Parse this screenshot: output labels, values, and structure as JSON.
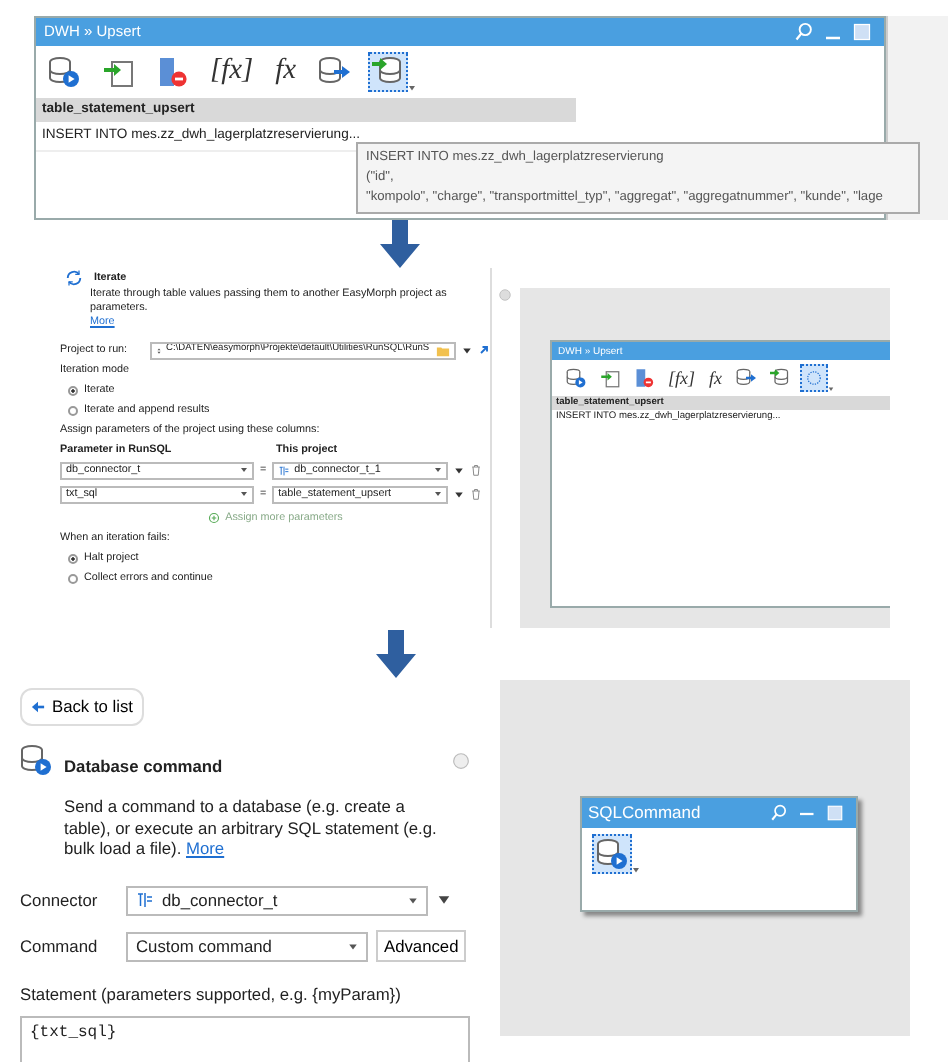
{
  "top_window": {
    "title": "DWH » Upsert",
    "toolbar": [
      {
        "kind": "db-run",
        "selected": false
      },
      {
        "kind": "import",
        "selected": false
      },
      {
        "kind": "remove-column",
        "selected": false
      },
      {
        "kind": "glyph",
        "text": "[fx]",
        "selected": false
      },
      {
        "kind": "glyph",
        "text": "fx",
        "selected": false
      },
      {
        "kind": "export",
        "selected": false
      },
      {
        "kind": "upsert",
        "selected": true
      }
    ],
    "table": {
      "columns": [
        "table_statement_upsert"
      ],
      "rows": [
        "INSERT INTO mes.zz_dwh_lagerplatzreservierung..."
      ]
    },
    "tooltip": {
      "lines": [
        "INSERT INTO mes.zz_dwh_lagerplatzreservierung",
        "(\"id\",",
        "\"kompolo\", \"charge\", \"transportmittel_typ\", \"aggregat\", \"aggregatnummer\", \"kunde\", \"lage"
      ]
    }
  },
  "iterate_panel": {
    "title": "Iterate",
    "description": "Iterate through table values passing them to another EasyMorph project as parameters.",
    "more_link": "More",
    "project_label": "Project to run:",
    "project_path": "C:\\DATEN\\easymorph\\Projekte\\default\\Utilities\\RunSQL\\RunS",
    "mode_label": "Iteration mode",
    "modes": [
      {
        "label": "Iterate",
        "selected": true
      },
      {
        "label": "Iterate and append results",
        "selected": false
      }
    ],
    "assign_label": "Assign parameters of the project using these columns:",
    "param_header": "Parameter in RunSQL",
    "project_header": "This project",
    "params": [
      {
        "parameter": "db_connector_t",
        "equals": "=",
        "value": "db_connector_t_1",
        "kind": "connector"
      },
      {
        "parameter": "txt_sql",
        "equals": "=",
        "value": "table_statement_upsert",
        "kind": "column"
      }
    ],
    "assign_more": "Assign more parameters",
    "fail_label": "When an iteration fails:",
    "fail_modes": [
      {
        "label": "Halt project",
        "selected": true
      },
      {
        "label": "Collect errors and continue",
        "selected": false
      }
    ]
  },
  "mini_window": {
    "title": "DWH » Upsert",
    "toolbar": [
      {
        "kind": "db-run",
        "selected": false
      },
      {
        "kind": "import",
        "selected": false
      },
      {
        "kind": "remove-column",
        "selected": false
      },
      {
        "kind": "glyph",
        "text": "[fx]",
        "selected": false
      },
      {
        "kind": "glyph",
        "text": "fx",
        "selected": false
      },
      {
        "kind": "export",
        "selected": false
      },
      {
        "kind": "upsert",
        "selected": false
      },
      {
        "kind": "blank",
        "selected": true
      }
    ],
    "table": {
      "columns": [
        "table_statement_upsert"
      ],
      "rows": [
        "INSERT INTO mes.zz_dwh_lagerplatzreservierung..."
      ]
    }
  },
  "db_command_panel": {
    "back_button": "Back to list",
    "title": "Database command",
    "description": "Send a command to a database (e.g. create a table), or execute an arbitrary SQL statement (e.g. bulk load a file).",
    "more_link": "More",
    "connector_label": "Connector",
    "connector_value": "db_connector_t",
    "command_label": "Command",
    "command_value": "Custom command",
    "advanced_button": "Advanced",
    "statement_label": "Statement (parameters supported, e.g. {myParam})",
    "statement_value": "{txt_sql}"
  },
  "sql_window": {
    "title": "SQLCommand",
    "toolbar": [
      {
        "kind": "db-run",
        "selected": true
      }
    ]
  }
}
